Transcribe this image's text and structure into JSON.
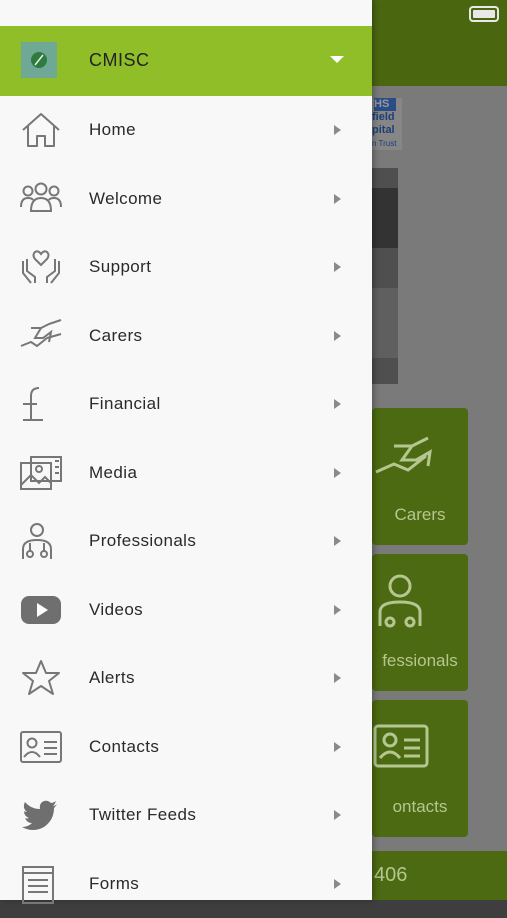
{
  "background": {
    "logo_lines": [
      "HS",
      "field",
      "pital",
      "n Trust"
    ],
    "tiles": [
      {
        "label": "Carers",
        "icon": "carers-icon"
      },
      {
        "label": "fessionals",
        "icon": "professionals-icon"
      },
      {
        "label": "ontacts",
        "icon": "contacts-icon"
      }
    ],
    "bottom_text": "406"
  },
  "drawer": {
    "header": {
      "title": "CMISC",
      "accent": "#8fbe28"
    },
    "items": [
      {
        "label": "Home",
        "icon": "home-icon"
      },
      {
        "label": "Welcome",
        "icon": "people-icon"
      },
      {
        "label": "Support",
        "icon": "hands-heart-icon"
      },
      {
        "label": "Carers",
        "icon": "handshake-icon"
      },
      {
        "label": "Financial",
        "icon": "pound-icon"
      },
      {
        "label": "Media",
        "icon": "media-icon"
      },
      {
        "label": "Professionals",
        "icon": "doctor-icon"
      },
      {
        "label": "Videos",
        "icon": "play-icon"
      },
      {
        "label": "Alerts",
        "icon": "star-icon"
      },
      {
        "label": "Contacts",
        "icon": "contact-card-icon"
      },
      {
        "label": "Twitter Feeds",
        "icon": "twitter-icon"
      },
      {
        "label": "Forms",
        "icon": "form-icon"
      }
    ]
  }
}
